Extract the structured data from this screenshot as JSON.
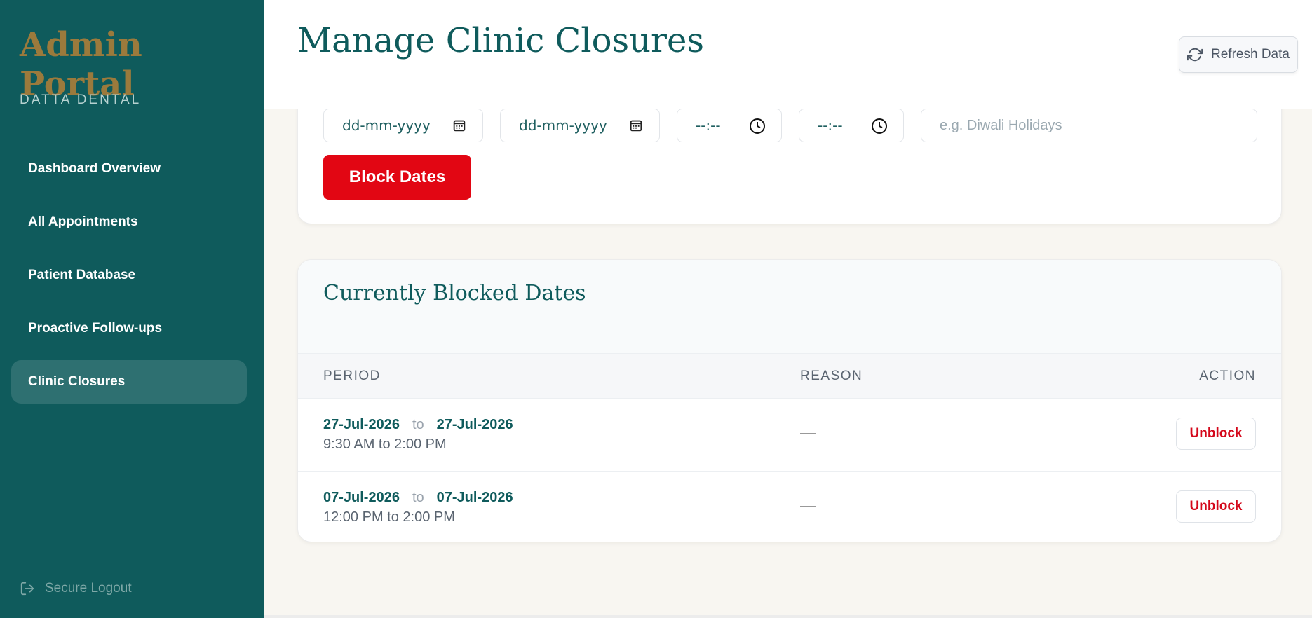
{
  "sidebar": {
    "brand_title": "Admin Portal",
    "brand_sub": "DATTA DENTAL",
    "items": [
      {
        "label": "Dashboard Overview"
      },
      {
        "label": "All Appointments"
      },
      {
        "label": "Patient Database"
      },
      {
        "label": "Proactive Follow-ups"
      },
      {
        "label": "Clinic Closures"
      }
    ],
    "active_index": 4,
    "logout_label": "Secure Logout"
  },
  "header": {
    "title": "Manage Clinic Closures",
    "refresh_label": "Refresh Data"
  },
  "form": {
    "start_date_placeholder": "dd-mm-yyyy",
    "end_date_placeholder": "dd-mm-yyyy",
    "start_time_placeholder": "--:--",
    "end_time_placeholder": "--:--",
    "reason_placeholder": "e.g. Diwali Holidays",
    "block_button_label": "Block Dates"
  },
  "blocked": {
    "title": "Currently Blocked Dates",
    "columns": {
      "period": "PERIOD",
      "reason": "REASON",
      "action": "ACTION"
    },
    "rows": [
      {
        "from": "27-Jul-2026",
        "to_word": "to",
        "to": "27-Jul-2026",
        "times": "9:30 AM to 2:00 PM",
        "reason": "—",
        "action": "Unblock"
      },
      {
        "from": "07-Jul-2026",
        "to_word": "to",
        "to": "07-Jul-2026",
        "times": "12:00 PM to 2:00 PM",
        "reason": "—",
        "action": "Unblock"
      }
    ]
  },
  "colors": {
    "sidebar_bg": "#0f5b5c",
    "brand_gold": "#9b7a3c",
    "danger": "#e20613",
    "teal_text": "#0f5b5c"
  },
  "icons": {
    "refresh": "refresh-icon",
    "calendar": "calendar-icon",
    "clock": "clock-icon",
    "logout": "logout-icon"
  }
}
